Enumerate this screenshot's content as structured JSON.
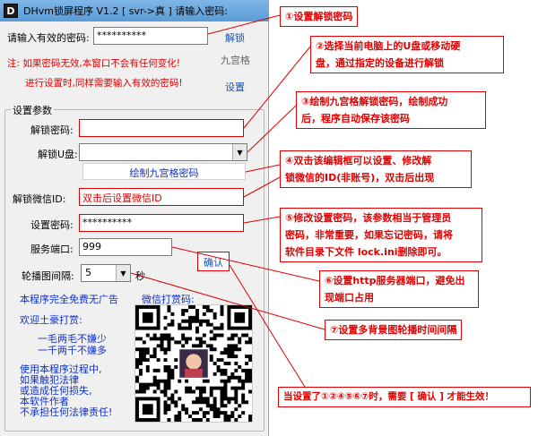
{
  "window": {
    "title": "DHvm锁屏程序 V1.2 [ svr->真 ] 请输入密码:",
    "logo_char": "D"
  },
  "top": {
    "password_label": "请输入有效的密码:",
    "password_value": "**********",
    "unlock_link": "解锁",
    "ninegrid_link": "九宫格",
    "settings_link": "设置",
    "warning1": "注: 如果密码无效,本窗口不会有任何变化!",
    "warning2": "进行设置时,同样需要输入有效的密码!"
  },
  "settings": {
    "group_label": "设置参数",
    "unlock_pwd_label": "解锁密码:",
    "unlock_pwd_value": "",
    "usb_label": "解锁U盘:",
    "usb_value": "",
    "ninegrid_button": "绘制九宫格密码",
    "wechat_label": "解锁微信ID:",
    "wechat_value": "双击后设置微信ID",
    "setpwd_label": "设置密码:",
    "setpwd_value": "**********",
    "port_label": "服务端口:",
    "port_value": "999",
    "interval_label": "轮播图间隔:",
    "interval_value": "5",
    "interval_unit": "秒",
    "confirm_button": "确认"
  },
  "footer": {
    "free_text": "本程序完全免费无广告",
    "wechat_pay": "微信打赏码:",
    "welcome": "欢迎土豪打赏:",
    "line1": "一毛两毛不嫌少",
    "line2": "一千两千不嫌多",
    "disclaimer1": "使用本程序过程中,",
    "disclaimer2": "如果触犯法律",
    "disclaimer3": "或造成任何损失,",
    "disclaimer4": "本软件作者",
    "disclaimer5": "不承担任何法律责任!"
  },
  "notes": {
    "n1": "①设置解锁密码",
    "n2a": "②选择当前电脑上的U盘或移动硬",
    "n2b": "盘，通过指定的设备进行解锁",
    "n3a": "③绘制九宫格解锁密码，绘制成功",
    "n3b": "后，程序自动保存该密码",
    "n4a": "④双击该编辑框可以设置、修改解",
    "n4b": "锁微信的ID(非账号)，双击后出现",
    "n5a": "⑤修改设置密码，该参数相当于管理员",
    "n5b": "密码，非常重要，如果忘记密码，请将",
    "n5c": "软件目录下文件 lock.ini删除即可。",
    "n6a": "⑥设置http服务器端口，避免出",
    "n6b": "现端口占用",
    "n7": "⑦设置多背景图轮播时间间隔",
    "n8": "当设置了①②④⑤⑥⑦时，需要 [ 确认 ] 才能生效！"
  },
  "colors": {
    "annotation": "#e00000",
    "link": "#1a4fb4",
    "titlebar": "#5a9bd6"
  }
}
